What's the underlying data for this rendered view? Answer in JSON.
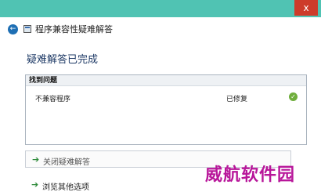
{
  "window": {
    "title": "程序兼容性疑难解答",
    "close_glyph": "x"
  },
  "main": {
    "heading": "疑难解答已完成",
    "results": {
      "header": "找到问题",
      "rows": [
        {
          "name": "不兼容程序",
          "status": "已修复",
          "status_icon": "check-circle-icon"
        }
      ]
    }
  },
  "actions": {
    "close_troubleshooter": "关闭疑难解答",
    "explore_more": "浏览其他选项"
  },
  "watermark": "威航软件园",
  "colors": {
    "topbar": "#50c3b3",
    "close_button": "#cd3b2a",
    "accent_blue": "#1e6fb4",
    "heading": "#1e3a66",
    "success_green": "#6fae3c",
    "watermark": "#b8169a"
  }
}
